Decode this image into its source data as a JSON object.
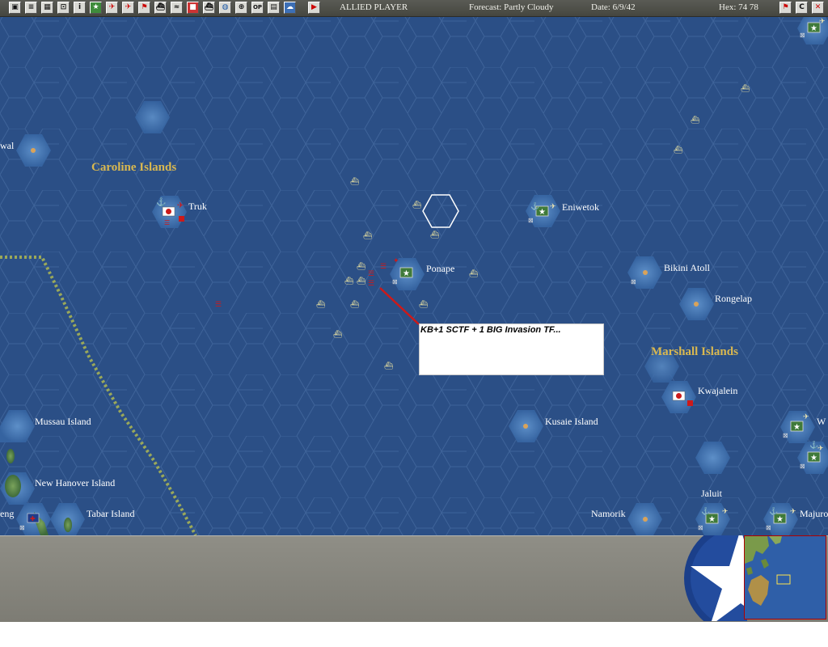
{
  "header": {
    "player": "ALLIED PLAYER",
    "forecast": "Forecast: Partly Cloudy",
    "date": "Date: 6/9/42",
    "hex": "Hex: 74 78"
  },
  "toolbar": {
    "buttons": [
      "save-icon",
      "document-icon",
      "list-icon",
      "air-icon",
      "info-icon",
      "star-icon",
      "plane-icon",
      "plane-2-icon",
      "flag-icon",
      "ship-icon",
      "route-icon",
      "unit-icon",
      "ship-2-icon",
      "globe-icon",
      "target-icon",
      "op-icon",
      "grid-icon",
      "cloud-icon"
    ],
    "op_label": "OP",
    "info_label": "i",
    "right_buttons": [
      "flag-surrender-icon",
      "c-icon",
      "close-icon"
    ],
    "c_label": "C"
  },
  "map": {
    "places": {
      "truk": "Truk",
      "ponape": "Ponape",
      "eniwetok": "Eniwetok",
      "bikini": "Bikini Atoll",
      "rongelap": "Rongelap",
      "kwajalein": "Kwajalein",
      "kusaie": "Kusaie Island",
      "mussau": "Mussau Island",
      "newhanover": "New Hanover Island",
      "tabar": "Tabar Island",
      "namorik": "Namorik",
      "jaluit": "Jaluit",
      "majuro": "Majuro",
      "wal": "wal",
      "eng": "eng",
      "w": "W"
    },
    "regions": {
      "caroline": "Caroline Islands",
      "marshall": "Marshall Islands"
    },
    "tf_note": "KB+1 SCTF + 1 BIG Invasion TF..."
  },
  "colors": {
    "ocean": "#2b4f86",
    "hex_line": "#3d6298",
    "region_label": "#d9b850",
    "supply_line": "#9aa85a",
    "japan_red": "#cc1a1a",
    "allied_green": "#3f7a3a"
  }
}
